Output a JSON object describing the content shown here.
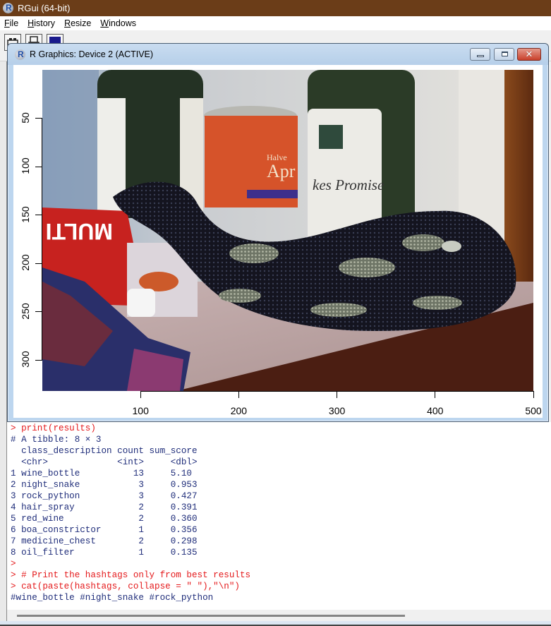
{
  "app": {
    "title": "RGui (64-bit)",
    "menu": [
      {
        "label": "File",
        "accel": "F",
        "rest": "ile"
      },
      {
        "label": "History",
        "accel": "H",
        "rest": "istory"
      },
      {
        "label": "Resize",
        "accel": "R",
        "rest": "esize"
      },
      {
        "label": "Windows",
        "accel": "W",
        "rest": "indows"
      }
    ],
    "toolbar_icons": [
      "open-script-icon",
      "print-icon",
      "console-icon"
    ]
  },
  "graphics_window": {
    "title": "R Graphics: Device 2 (ACTIVE)",
    "buttons": {
      "minimize": "minimize",
      "maximize": "maximize",
      "close": "close"
    },
    "plot": {
      "image_description": "Photo: black snake with pale blotches coiled on a table next to wine bottles, an orange can, a red box labelled MULTI and a patterned cloth",
      "image_labels_visible": [
        "Apr",
        "Halve",
        "Promise",
        "MULTI"
      ],
      "x_axis": {
        "ticks": [
          "100",
          "200",
          "300",
          "400",
          "500"
        ],
        "range": [
          0,
          500
        ]
      },
      "y_axis": {
        "ticks": [
          "50",
          "100",
          "150",
          "200",
          "250",
          "300"
        ],
        "range": [
          0,
          332
        ],
        "reversed": true
      }
    }
  },
  "console": {
    "lines": [
      {
        "type": "in",
        "text": "> print(results)"
      },
      {
        "type": "out",
        "text": "# A tibble: 8 × 3"
      },
      {
        "type": "out",
        "text": "  class_description count sum_score"
      },
      {
        "type": "out",
        "text": "  <chr>             <int>     <dbl>"
      },
      {
        "type": "out",
        "text": "1 wine_bottle          13     5.10 "
      },
      {
        "type": "out",
        "text": "2 night_snake           3     0.953"
      },
      {
        "type": "out",
        "text": "3 rock_python           3     0.427"
      },
      {
        "type": "out",
        "text": "4 hair_spray            2     0.391"
      },
      {
        "type": "out",
        "text": "5 red_wine              2     0.360"
      },
      {
        "type": "out",
        "text": "6 boa_constrictor       1     0.356"
      },
      {
        "type": "out",
        "text": "7 medicine_chest        2     0.298"
      },
      {
        "type": "out",
        "text": "8 oil_filter            1     0.135"
      },
      {
        "type": "in",
        "text": ">"
      },
      {
        "type": "in",
        "text": "> # Print the hashtags only from best results"
      },
      {
        "type": "in",
        "text": "> cat(paste(hashtags, collapse = \" \"),\"\\n\")"
      },
      {
        "type": "out",
        "text": "#wine_bottle #night_snake #rock_python"
      }
    ],
    "table": {
      "title": "A tibble: 8 × 3",
      "columns": [
        "class_description",
        "count",
        "sum_score"
      ],
      "types": [
        "<chr>",
        "<int>",
        "<dbl>"
      ],
      "rows": [
        [
          "wine_bottle",
          13,
          "5.10"
        ],
        [
          "night_snake",
          3,
          "0.953"
        ],
        [
          "rock_python",
          3,
          "0.427"
        ],
        [
          "hair_spray",
          2,
          "0.391"
        ],
        [
          "red_wine",
          2,
          "0.360"
        ],
        [
          "boa_constrictor",
          1,
          "0.356"
        ],
        [
          "medicine_chest",
          2,
          "0.298"
        ],
        [
          "oil_filter",
          1,
          "0.135"
        ]
      ]
    },
    "hashtags": "#wine_bottle #night_snake #rock_python",
    "colors": {
      "input": "#e4191b",
      "output": "#1f2d7a"
    }
  }
}
